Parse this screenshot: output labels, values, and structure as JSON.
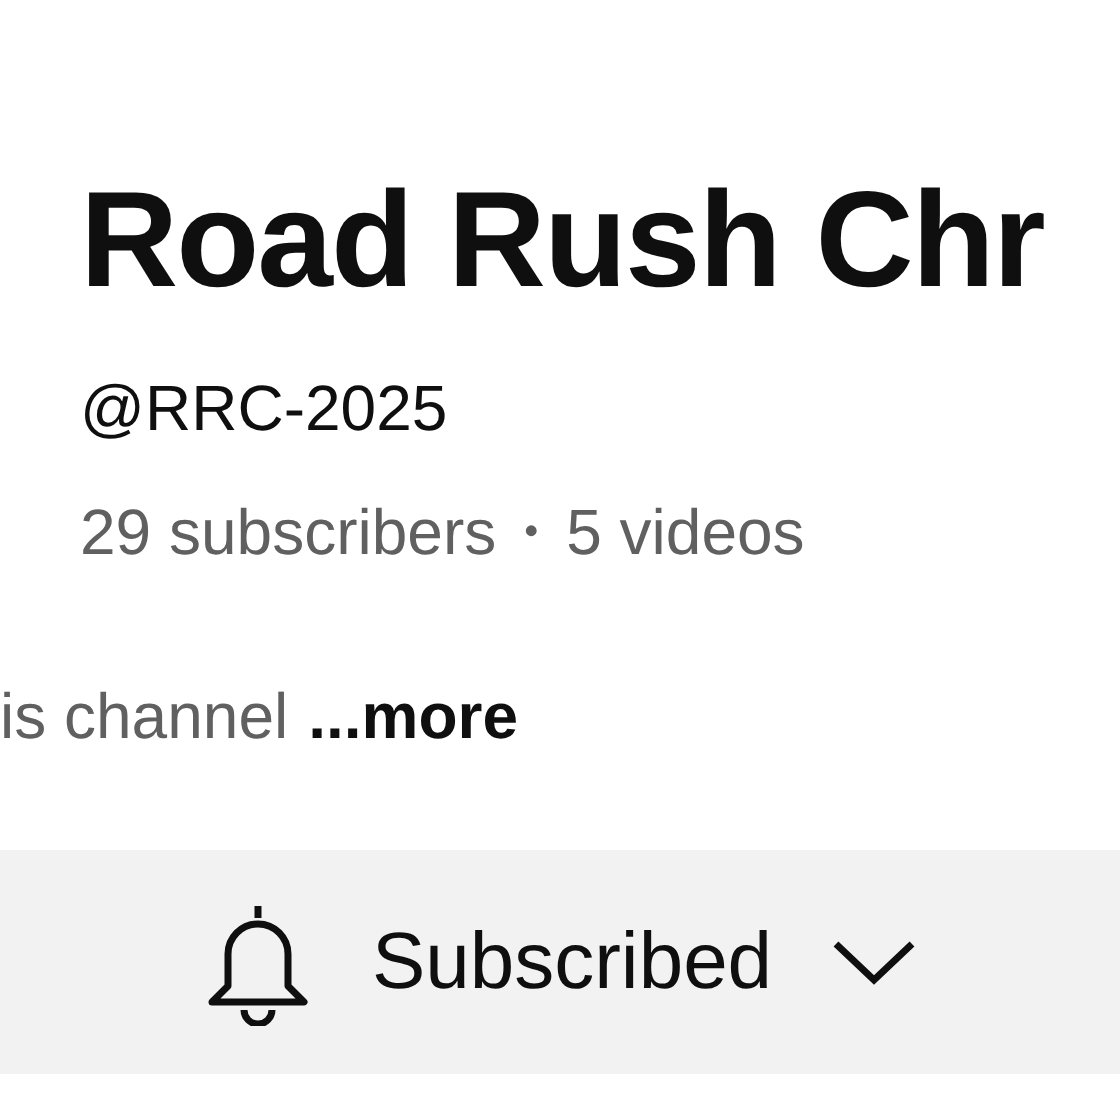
{
  "channel": {
    "title": "Road Rush Chr",
    "handle": "@RRC-2025",
    "stats": [
      "29 subscribers",
      "5 videos"
    ],
    "stats_separator": "•",
    "description": "is channel",
    "more_link": "...more"
  },
  "subscribe_button": {
    "label": "Subscribed"
  }
}
